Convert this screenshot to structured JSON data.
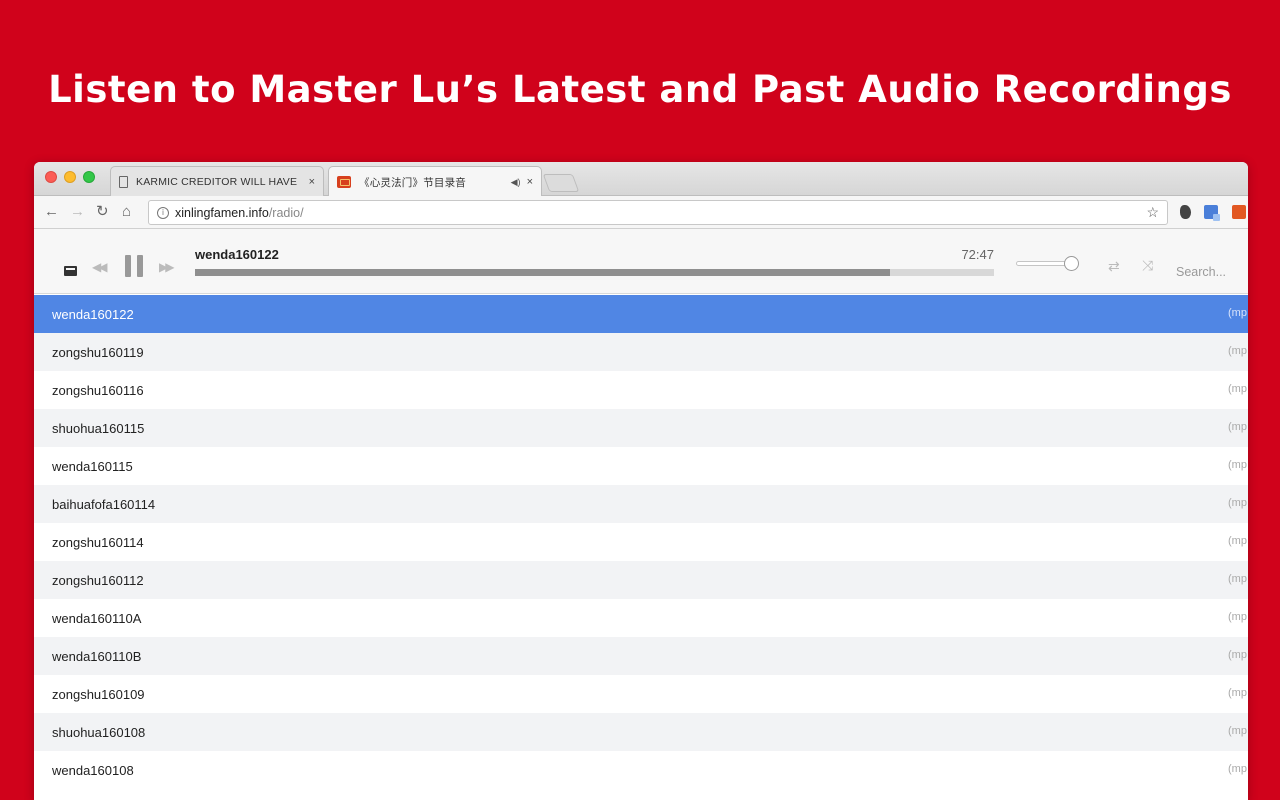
{
  "headline": "Listen to Master Lu’s Latest and Past Audio Recordings",
  "browser": {
    "tabs": [
      {
        "title": "KARMIC CREDITOR WILL HAVE",
        "close": "×"
      },
      {
        "title": "《心灵法门》节目录音",
        "audio": "◀)",
        "close": "×"
      }
    ],
    "url_host": "xinlingfamen.info",
    "url_path": "/radio/",
    "nav": {
      "back": "←",
      "forward": "→",
      "reload": "↻",
      "home": "⌂"
    },
    "star": "☆"
  },
  "player": {
    "track_title": "wenda160122",
    "time": "72:47",
    "progress": 0.87,
    "volume": 0.88,
    "prev_glyph": "◀◀",
    "next_glyph": "▶▶",
    "repeat_glyph": "⇄",
    "shuffle_glyph": "⤨",
    "search_placeholder": "Search..."
  },
  "tracks": [
    {
      "name": "wenda160122",
      "fmt": "(mp",
      "active": true
    },
    {
      "name": "zongshu160119",
      "fmt": "(mp"
    },
    {
      "name": "zongshu160116",
      "fmt": "(mp"
    },
    {
      "name": "shuohua160115",
      "fmt": "(mp"
    },
    {
      "name": "wenda160115",
      "fmt": "(mp"
    },
    {
      "name": "baihuafofa160114",
      "fmt": "(mp"
    },
    {
      "name": "zongshu160114",
      "fmt": "(mp"
    },
    {
      "name": "zongshu160112",
      "fmt": "(mp"
    },
    {
      "name": "wenda160110A",
      "fmt": "(mp"
    },
    {
      "name": "wenda160110B",
      "fmt": "(mp"
    },
    {
      "name": "zongshu160109",
      "fmt": "(mp"
    },
    {
      "name": "shuohua160108",
      "fmt": "(mp"
    },
    {
      "name": "wenda160108",
      "fmt": "(mp"
    }
  ]
}
